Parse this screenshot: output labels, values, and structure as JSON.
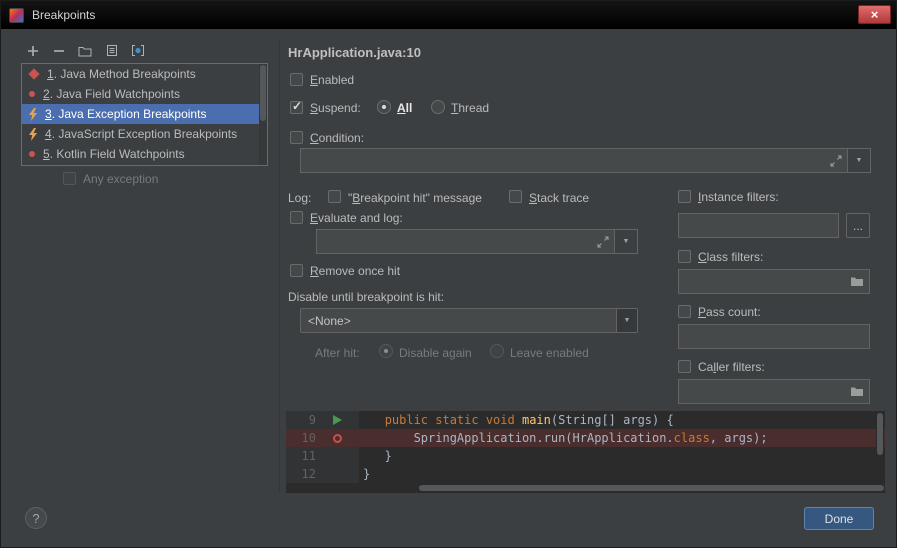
{
  "window": {
    "title": "Breakpoints",
    "close_glyph": "×"
  },
  "left_panel": {
    "toolbar_icons": [
      "add",
      "remove",
      "group-by-package",
      "group-by-file",
      "group-by-class"
    ],
    "items": [
      {
        "label": "1. Java Method Breakpoints",
        "icon": "method-breakpoint",
        "selected": false
      },
      {
        "label": "2. Java Field Watchpoints",
        "icon": "field-watchpoint",
        "selected": false
      },
      {
        "label": "3. Java Exception Breakpoints",
        "icon": "exception-breakpoint",
        "selected": true
      },
      {
        "label": "4. JavaScript Exception Breakpoints",
        "icon": "exception-breakpoint",
        "selected": false
      },
      {
        "label": "5. Kotlin Field Watchpoints",
        "icon": "field-watchpoint",
        "selected": false
      }
    ],
    "any_exception_label": "Any exception"
  },
  "details": {
    "header": "HrApplication.java:10",
    "enabled_label": "Enabled",
    "suspend_label": "Suspend:",
    "suspend_all_label": "All",
    "suspend_thread_label": "Thread",
    "condition_label": "Condition:",
    "log_label": "Log:",
    "log_message_label": "\"Breakpoint hit\" message",
    "stack_trace_label": "Stack trace",
    "evaluate_label": "Evaluate and log:",
    "remove_once_label": "Remove once hit",
    "disable_until_label": "Disable until breakpoint is hit:",
    "disable_until_value": "<None>",
    "after_hit_label": "After hit:",
    "disable_again_label": "Disable again",
    "leave_enabled_label": "Leave enabled",
    "instance_filters_label": "Instance filters:",
    "more_button_label": "...",
    "class_filters_label": "Class filters:",
    "pass_count_label": "Pass count:",
    "caller_filters_label": "Caller filters:"
  },
  "state": {
    "enabled": false,
    "suspend": true,
    "suspend_mode": "All",
    "condition": false,
    "log_message": false,
    "stack_trace": false,
    "evaluate_and_log": false,
    "remove_once_hit": false,
    "disable_until": "<None>",
    "after_hit": "Disable again",
    "instance_filters": false,
    "class_filters": false,
    "pass_count": false,
    "caller_filters": false,
    "any_exception": false
  },
  "editor": {
    "lines": [
      {
        "num": "9",
        "icon": "arrow",
        "highlight": false,
        "segments": [
          {
            "t": "   ",
            "s": "pl"
          },
          {
            "t": "public static void ",
            "s": "kw"
          },
          {
            "t": "main",
            "s": "fn"
          },
          {
            "t": "(String[] args) {",
            "s": "pl"
          }
        ]
      },
      {
        "num": "10",
        "icon": "breakpoint",
        "highlight": true,
        "segments": [
          {
            "t": "       SpringApplication.run(HrApplication.",
            "s": "pl"
          },
          {
            "t": "class",
            "s": "kw"
          },
          {
            "t": ", args);",
            "s": "pl"
          }
        ]
      },
      {
        "num": "11",
        "icon": "",
        "highlight": false,
        "segments": [
          {
            "t": "   }",
            "s": "pl"
          }
        ]
      },
      {
        "num": "12",
        "icon": "",
        "highlight": false,
        "segments": [
          {
            "t": "}",
            "s": "pl"
          }
        ]
      }
    ]
  },
  "footer": {
    "help_label": "?",
    "done_label": "Done"
  },
  "colors": {
    "selection": "#4b6eaf",
    "accent_red": "#c75450",
    "done_button": "#365880",
    "breakpoint_line": "#4a2d2d",
    "editor_background": "#2b2b2b"
  }
}
